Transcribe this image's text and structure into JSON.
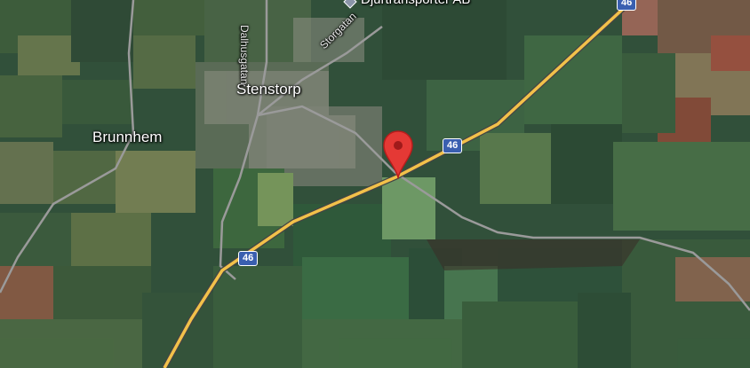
{
  "places": {
    "stenstorp": "Stenstorp",
    "brunnhem": "Brunnhem"
  },
  "streets": {
    "storgatan": "Storgatan",
    "dalhusgatan": "Dalhusgatan"
  },
  "poi": {
    "label": "Djurtransporter AB",
    "icon": "diamond-place-icon"
  },
  "roads": {
    "route_number": "46"
  },
  "marker": {
    "icon": "map-pin-icon",
    "color": "#e53935"
  },
  "colors": {
    "highway": "#f2c14a",
    "minor_road": "#9a9a9a",
    "shield": "#3a5fb0"
  }
}
